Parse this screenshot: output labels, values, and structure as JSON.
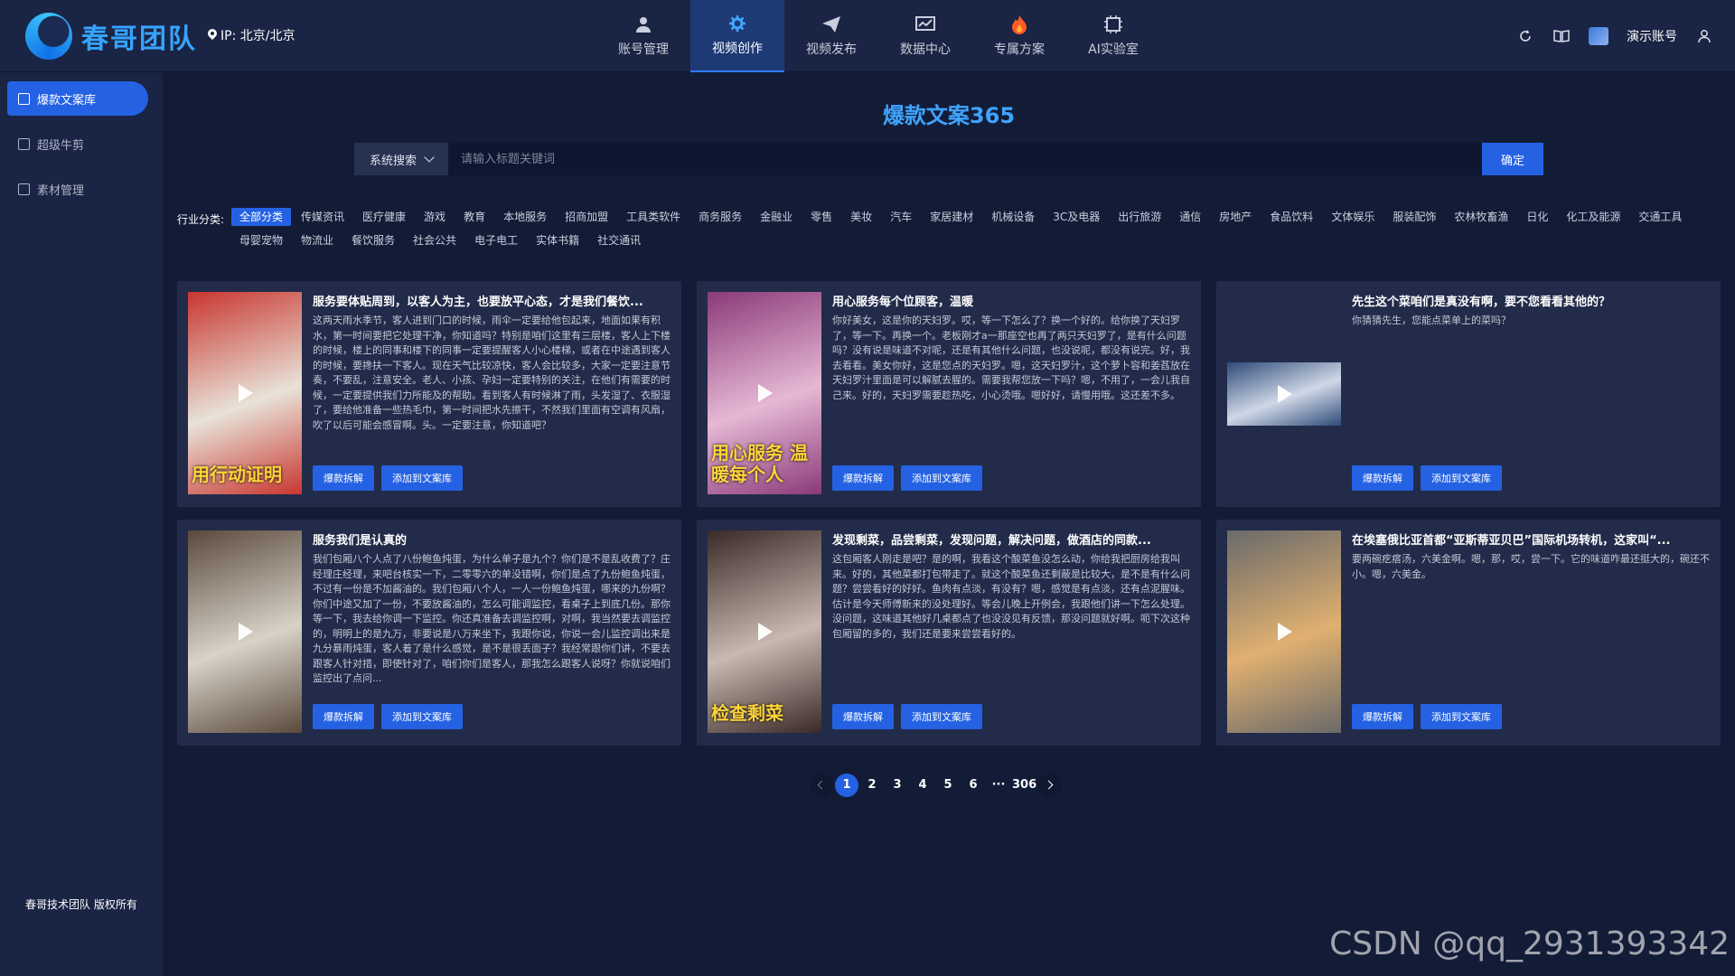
{
  "brand": {
    "name": "春哥团队"
  },
  "ip": {
    "label": "IP: 北京/北京"
  },
  "nav": {
    "items": [
      {
        "label": "账号管理",
        "icon": "user-icon"
      },
      {
        "label": "视频创作",
        "icon": "gear-icon",
        "active": true
      },
      {
        "label": "视频发布",
        "icon": "send-icon"
      },
      {
        "label": "数据中心",
        "icon": "chart-icon"
      },
      {
        "label": "专属方案",
        "icon": "fire-icon"
      },
      {
        "label": "AI实验室",
        "icon": "ai-chip-icon"
      }
    ]
  },
  "header_right": {
    "account": "演示账号"
  },
  "sidebar": {
    "items": [
      {
        "label": "爆款文案库",
        "active": true
      },
      {
        "label": "超级牛剪"
      },
      {
        "label": "素材管理"
      }
    ],
    "footer": "春哥技术团队 版权所有"
  },
  "main": {
    "title": "爆款文案365"
  },
  "search": {
    "select_label": "系统搜索",
    "placeholder": "请输入标题关键词",
    "button": "确定"
  },
  "industry": {
    "label": "行业分类:",
    "tags": [
      "全部分类",
      "传媒资讯",
      "医疗健康",
      "游戏",
      "教育",
      "本地服务",
      "招商加盟",
      "工具类软件",
      "商务服务",
      "金融业",
      "零售",
      "美妆",
      "汽车",
      "家居建材",
      "机械设备",
      "3C及电器",
      "出行旅游",
      "通信",
      "房地产",
      "食品饮料",
      "文体娱乐",
      "服装配饰",
      "农林牧畜渔",
      "日化",
      "化工及能源",
      "交通工具",
      "母婴宠物",
      "物流业",
      "餐饮服务",
      "社会公共",
      "电子电工",
      "实体书籍",
      "社交通讯"
    ]
  },
  "card_buttons": {
    "analyze": "爆款拆解",
    "add": "添加到文案库"
  },
  "cards": [
    {
      "title": "服务要体贴周到，以客人为主，也要放平心态，才是我们餐饮...",
      "body": "这两天雨水季节，客人进到门口的时候，雨伞一定要给他包起来，地面如果有积水，第一时间要把它处理干净，你知道吗？特别是咱们这里有三层楼，客人上下楼的时候，楼上的同事和楼下的同事一定要提醒客人小心楼梯，或者在中途遇到客人的时候，要搀扶一下客人。现在天气比较凉快，客人会比较多，大家一定要注意节奏，不要乱，注意安全。老人、小孩、孕妇一定要特别的关注，在他们有需要的时候，一定要提供我们力所能及的帮助。看到客人有时候淋了雨，头发湿了、衣服湿了，要给他准备一些热毛巾，第一时间把水先擦干，不然我们里面有空调有风扇，吹了以后可能会感冒啊。头。一定要注意，你知道吧？",
      "thumb_text": "用行动证明",
      "bg1": "#c8362f",
      "bg2": "#e8e2d8"
    },
    {
      "title": "用心服务每个位顾客，温暖",
      "body": "你好美女，这是你的天妇罗。哎，等一下怎么了？换一个好的。给你换了天妇罗了，等一下。再换一个。老板刚才a一那座空也再了两只天妇罗了，是有什么问题吗？没有说是味道不对呢，还是有其他什么问题，也没说呢，都没有说完。好，我去看看。美女你好，这是您点的天妇罗。嗯，这天妇罗汁，这个萝卜容和姜萏放在天妇罗汁里面是可以解腻去腥的。需要我帮您放一下吗？嗯，不用了，一会儿我自己来。好的，天妇罗需要趁热吃，小心烫哦。嗯好好，请慢用哦。这还差不多。",
      "thumb_text": "用心服务 温暖每个人",
      "bg1": "#8a3a78",
      "bg2": "#e6b8d4"
    },
    {
      "title": "先生这个菜咱们是真没有啊，要不您看看其他的？",
      "body": "你猜猜先生，您能点菜单上的菜吗？",
      "thumb_text": "",
      "bg1": "#2f4a7a",
      "bg2": "#cfd8e6"
    },
    {
      "title": "服务我们是认真的",
      "body": "我们包厢八个人点了八份鲍鱼炖蛋，为什么单子是九个？你们是不是乱收费了？庄经理庄经理，来吧台核实一下，二零零六的单没错啊，你们是点了九份鲍鱼炖蛋，不过有一份是不加酱油的。我们包厢八个人，一人一份鲍鱼炖蛋，哪来的九份啊？你们中途又加了一份，不要放酱油的，怎么可能调监控，看桌子上到底几份。那你等一下，我去给你调一下监控。你还真准备去调监控啊，对啊，我当然要去调监控的，明明上的是九万，非要说是八万来坐下，我跟你说，你说一会儿监控调出来是九分暴雨炖蛋，客人着了是什么感觉，是不是很丢面子？我经常跟你们讲，不要去跟客人针对措，即使针对了，咱们你们是客人，那我怎么跟客人说呀？你就说咱们监控出了点问...",
      "thumb_text": "",
      "bg1": "#5a4a3c",
      "bg2": "#d8d2c8"
    },
    {
      "title": "发现剩菜，品尝剩菜，发现问题，解决问题，做酒店的同款...",
      "body": "这包厢客人刚走是吧？是的啊，我看这个酸菜鱼没怎么动，你给我把厨房给我叫来。好的，其他菜都打包带走了。就这个酸菜鱼还剩蔽是比较大，是不是有什么问题？尝尝看好的好好。鱼肉有点淡，有没有？嗯，感觉是有点淡，还有点泥腥味。估计是今天师傅新来的没处理好。等会儿晚上开例会，我跟他们讲一下怎么处理。没问题，这味道其他好几桌都点了也没没见有反馈，那没问题就好啊。呃下次这种包厢留的多的，我们还是要来尝尝看好的。",
      "thumb_text": "检查剩菜",
      "bg1": "#3a2a28",
      "bg2": "#c8b8b0"
    },
    {
      "title": "在埃塞俄比亚首都“亚斯蒂亚贝巴”国际机场转机，这家叫“...",
      "body": "要两碗疙瘩汤，六美金啊。嗯，那，哎，尝一下。它的味道咋最还挺大的，碗还不小。嗯，六美金。",
      "thumb_text": "",
      "bg1": "#6a6a6a",
      "bg2": "#e0b070"
    }
  ],
  "pagination": {
    "pages": [
      "1",
      "2",
      "3",
      "4",
      "5",
      "6",
      "···",
      "306"
    ],
    "current": "1"
  },
  "watermark": "CSDN @qq_2931393342"
}
